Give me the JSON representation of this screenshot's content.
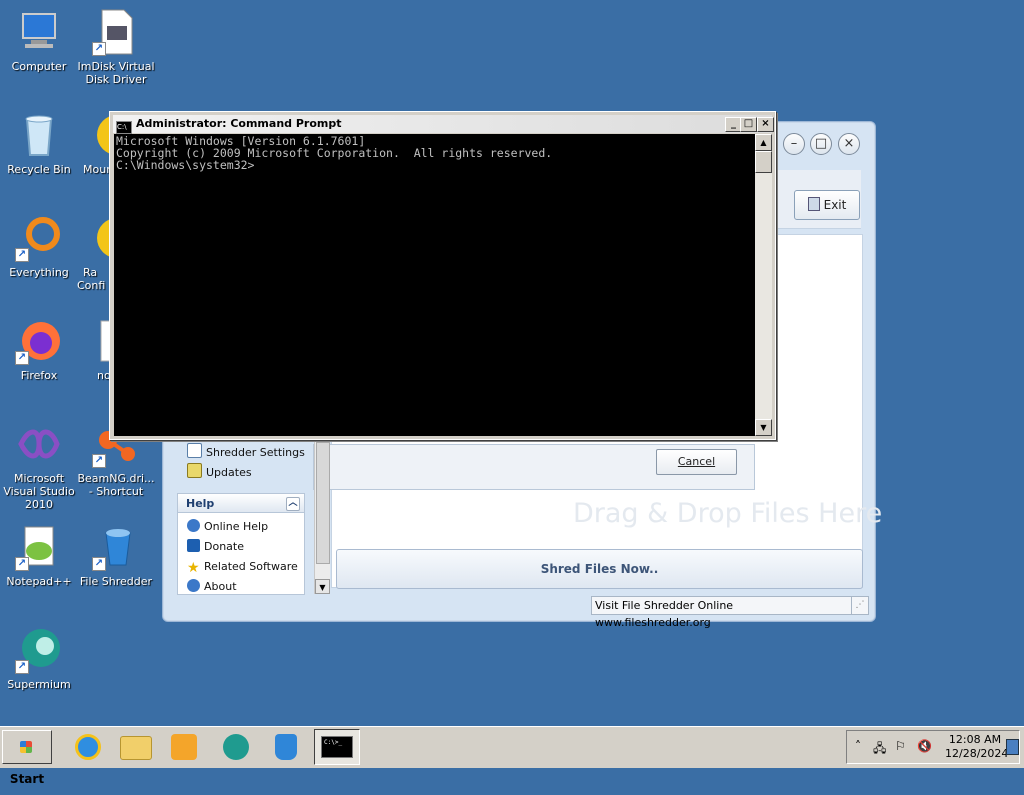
{
  "desktop_icons": [
    {
      "label": "Computer"
    },
    {
      "label": "ImDisk Virtual Disk Driver"
    },
    {
      "label": "Recycle Bin"
    },
    {
      "label": "Moun"
    },
    {
      "label": "Everything"
    },
    {
      "label": "Ra Confi"
    },
    {
      "label": "Firefox"
    },
    {
      "label": "no"
    },
    {
      "label": "Microsoft Visual Studio 2010"
    },
    {
      "label": "BeamNG.dri... - Shortcut"
    },
    {
      "label": "Notepad++"
    },
    {
      "label": "File Shredder"
    },
    {
      "label": "Supermium"
    }
  ],
  "cmd_window": {
    "title": "Administrator: Command Prompt",
    "lines": [
      "Microsoft Windows [Version 6.1.7601]",
      "Copyright (c) 2009 Microsoft Corporation.  All rights reserved.",
      "",
      "C:\\Windows\\system32>"
    ],
    "minimize": "_",
    "maximize": "□",
    "close": "×"
  },
  "shredder_window": {
    "exit_label": "Exit",
    "cancel_label": "Cancel",
    "drag_drop_text": "Drag & Drop Files Here",
    "shred_button": "Shred Files Now..",
    "status_link": "Visit File Shredder Online",
    "status_url": "www.fileshredder.org",
    "tasks": [
      {
        "label": "Shredder Settings"
      },
      {
        "label": "Updates"
      }
    ],
    "help_title": "Help",
    "help_items": [
      {
        "label": "Online Help"
      },
      {
        "label": "Donate"
      },
      {
        "label": "Related Software"
      },
      {
        "label": "About"
      }
    ]
  },
  "taskbar": {
    "start_label": "Start",
    "clock_time": "12:08 AM",
    "clock_date": "12/28/2024",
    "cmd_thumb_text": "C:\\>_"
  }
}
